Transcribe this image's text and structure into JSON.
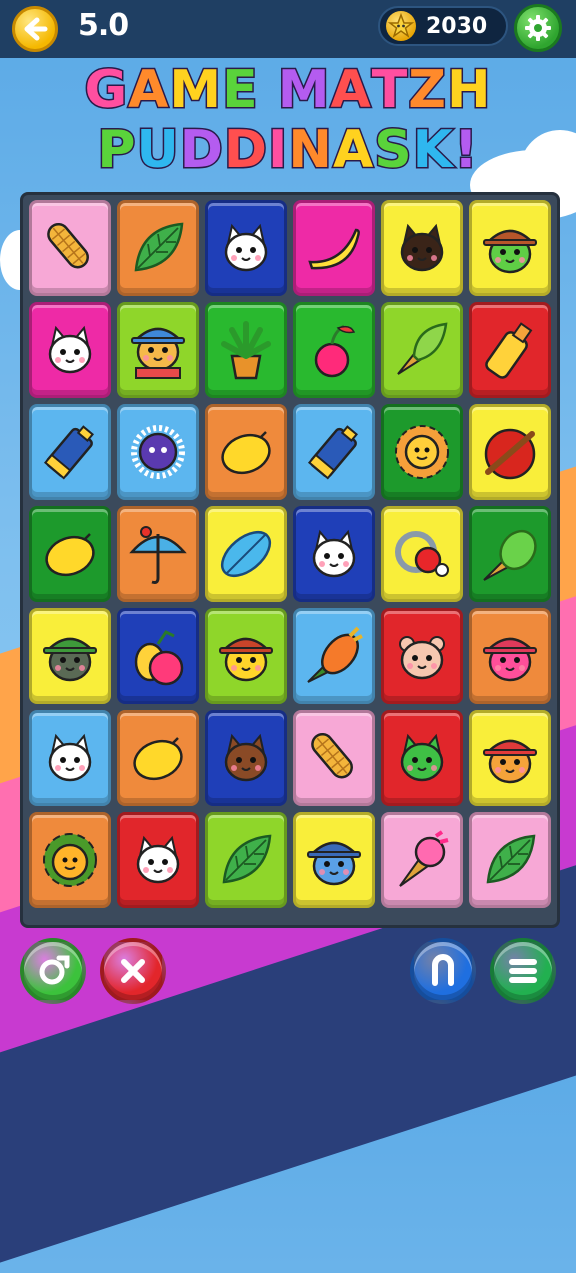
{
  "header": {
    "level": "5.0",
    "score": "2030",
    "back_icon": "back-arrow-icon",
    "score_icon": "star-coin-icon",
    "settings_icon": "gear-icon"
  },
  "title": {
    "line1": "GAME MATZH",
    "line2": "PUDDINASK!"
  },
  "colors": {
    "pink": "#f7a8d6",
    "orange": "#ef8a3c",
    "blue": "#1f3fb8",
    "magenta": "#ee2aa6",
    "yellow": "#f9ee3a",
    "lime": "#8fd62a",
    "green": "#29b92f",
    "red": "#e1262b",
    "sky": "#5cb6ef",
    "darkgreen": "#1d9a2c"
  },
  "board": {
    "rows": [
      [
        {
          "color": "pink",
          "icon": "corn-cob-icon"
        },
        {
          "color": "orange",
          "icon": "leaf-icon"
        },
        {
          "color": "blue",
          "icon": "white-cat-icon"
        },
        {
          "color": "magenta",
          "icon": "banana-icon"
        },
        {
          "color": "yellow",
          "icon": "black-cat-icon"
        },
        {
          "color": "yellow",
          "icon": "frog-hat-icon"
        }
      ],
      [
        {
          "color": "magenta",
          "icon": "white-cat-icon"
        },
        {
          "color": "lime",
          "icon": "hat-kid-icon"
        },
        {
          "color": "green",
          "icon": "potted-plant-icon"
        },
        {
          "color": "green",
          "icon": "cherry-icon"
        },
        {
          "color": "lime",
          "icon": "leaf-cone-icon"
        },
        {
          "color": "red",
          "icon": "yellow-bottle-icon"
        }
      ],
      [
        {
          "color": "sky",
          "icon": "battery-icon"
        },
        {
          "color": "sky",
          "icon": "urchin-icon"
        },
        {
          "color": "orange",
          "icon": "lemon-icon"
        },
        {
          "color": "sky",
          "icon": "battery-icon"
        },
        {
          "color": "darkgreen",
          "icon": "sun-icon"
        },
        {
          "color": "yellow",
          "icon": "red-ball-icon"
        }
      ],
      [
        {
          "color": "darkgreen",
          "icon": "lemon-icon"
        },
        {
          "color": "orange",
          "icon": "umbrella-icon"
        },
        {
          "color": "yellow",
          "icon": "blue-leaf-icon"
        },
        {
          "color": "blue",
          "icon": "white-cat-icon"
        },
        {
          "color": "yellow",
          "icon": "ring-icon"
        },
        {
          "color": "darkgreen",
          "icon": "green-cone-icon"
        }
      ],
      [
        {
          "color": "yellow",
          "icon": "green-hat-kid-icon"
        },
        {
          "color": "blue",
          "icon": "fruit-pair-icon"
        },
        {
          "color": "lime",
          "icon": "yellow-hat-kid-icon"
        },
        {
          "color": "sky",
          "icon": "carrot-cone-icon"
        },
        {
          "color": "red",
          "icon": "bear-icon"
        },
        {
          "color": "orange",
          "icon": "pink-hat-kid-icon"
        }
      ],
      [
        {
          "color": "sky",
          "icon": "white-cat-icon"
        },
        {
          "color": "orange",
          "icon": "lemon-icon"
        },
        {
          "color": "blue",
          "icon": "brown-cat-icon"
        },
        {
          "color": "pink",
          "icon": "corn-cob-icon"
        },
        {
          "color": "red",
          "icon": "green-cat-icon"
        },
        {
          "color": "yellow",
          "icon": "orange-hat-kid-icon"
        }
      ],
      [
        {
          "color": "orange",
          "icon": "sunflower-icon"
        },
        {
          "color": "red",
          "icon": "white-cat-icon"
        },
        {
          "color": "lime",
          "icon": "leaf-icon"
        },
        {
          "color": "yellow",
          "icon": "blue-hat-kid-icon"
        },
        {
          "color": "pink",
          "icon": "ice-cream-icon"
        },
        {
          "color": "pink",
          "icon": "leaf-icon"
        }
      ]
    ]
  },
  "bottom_buttons": [
    {
      "name": "shuffle-button",
      "icon": "shuffle-icon",
      "color": "#3cc23c"
    },
    {
      "name": "close-button",
      "icon": "close-icon",
      "color": "#e2262b"
    },
    {
      "name": "magnet-button",
      "icon": "magnet-icon",
      "color": "#1f6fe0"
    },
    {
      "name": "menu-button",
      "icon": "menu-icon",
      "color": "#22b050"
    }
  ]
}
